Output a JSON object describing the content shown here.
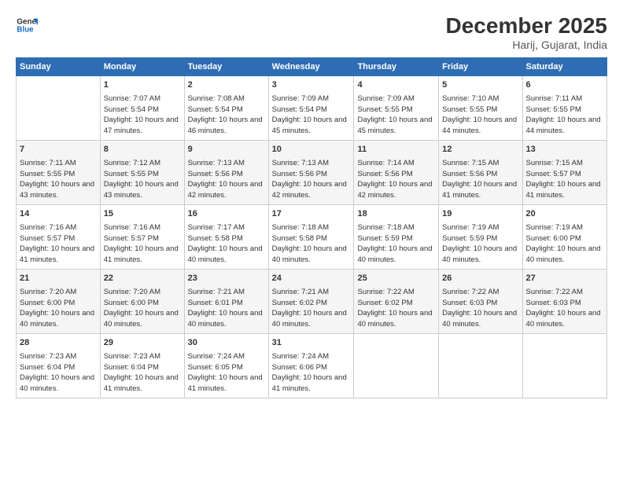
{
  "logo": {
    "line1": "General",
    "line2": "Blue"
  },
  "title": "December 2025",
  "location": "Harij, Gujarat, India",
  "weekdays": [
    "Sunday",
    "Monday",
    "Tuesday",
    "Wednesday",
    "Thursday",
    "Friday",
    "Saturday"
  ],
  "weeks": [
    [
      {
        "day": "",
        "sunrise": "",
        "sunset": "",
        "daylight": ""
      },
      {
        "day": "1",
        "sunrise": "Sunrise: 7:07 AM",
        "sunset": "Sunset: 5:54 PM",
        "daylight": "Daylight: 10 hours and 47 minutes."
      },
      {
        "day": "2",
        "sunrise": "Sunrise: 7:08 AM",
        "sunset": "Sunset: 5:54 PM",
        "daylight": "Daylight: 10 hours and 46 minutes."
      },
      {
        "day": "3",
        "sunrise": "Sunrise: 7:09 AM",
        "sunset": "Sunset: 5:54 PM",
        "daylight": "Daylight: 10 hours and 45 minutes."
      },
      {
        "day": "4",
        "sunrise": "Sunrise: 7:09 AM",
        "sunset": "Sunset: 5:55 PM",
        "daylight": "Daylight: 10 hours and 45 minutes."
      },
      {
        "day": "5",
        "sunrise": "Sunrise: 7:10 AM",
        "sunset": "Sunset: 5:55 PM",
        "daylight": "Daylight: 10 hours and 44 minutes."
      },
      {
        "day": "6",
        "sunrise": "Sunrise: 7:11 AM",
        "sunset": "Sunset: 5:55 PM",
        "daylight": "Daylight: 10 hours and 44 minutes."
      }
    ],
    [
      {
        "day": "7",
        "sunrise": "Sunrise: 7:11 AM",
        "sunset": "Sunset: 5:55 PM",
        "daylight": "Daylight: 10 hours and 43 minutes."
      },
      {
        "day": "8",
        "sunrise": "Sunrise: 7:12 AM",
        "sunset": "Sunset: 5:55 PM",
        "daylight": "Daylight: 10 hours and 43 minutes."
      },
      {
        "day": "9",
        "sunrise": "Sunrise: 7:13 AM",
        "sunset": "Sunset: 5:56 PM",
        "daylight": "Daylight: 10 hours and 42 minutes."
      },
      {
        "day": "10",
        "sunrise": "Sunrise: 7:13 AM",
        "sunset": "Sunset: 5:56 PM",
        "daylight": "Daylight: 10 hours and 42 minutes."
      },
      {
        "day": "11",
        "sunrise": "Sunrise: 7:14 AM",
        "sunset": "Sunset: 5:56 PM",
        "daylight": "Daylight: 10 hours and 42 minutes."
      },
      {
        "day": "12",
        "sunrise": "Sunrise: 7:15 AM",
        "sunset": "Sunset: 5:56 PM",
        "daylight": "Daylight: 10 hours and 41 minutes."
      },
      {
        "day": "13",
        "sunrise": "Sunrise: 7:15 AM",
        "sunset": "Sunset: 5:57 PM",
        "daylight": "Daylight: 10 hours and 41 minutes."
      }
    ],
    [
      {
        "day": "14",
        "sunrise": "Sunrise: 7:16 AM",
        "sunset": "Sunset: 5:57 PM",
        "daylight": "Daylight: 10 hours and 41 minutes."
      },
      {
        "day": "15",
        "sunrise": "Sunrise: 7:16 AM",
        "sunset": "Sunset: 5:57 PM",
        "daylight": "Daylight: 10 hours and 41 minutes."
      },
      {
        "day": "16",
        "sunrise": "Sunrise: 7:17 AM",
        "sunset": "Sunset: 5:58 PM",
        "daylight": "Daylight: 10 hours and 40 minutes."
      },
      {
        "day": "17",
        "sunrise": "Sunrise: 7:18 AM",
        "sunset": "Sunset: 5:58 PM",
        "daylight": "Daylight: 10 hours and 40 minutes."
      },
      {
        "day": "18",
        "sunrise": "Sunrise: 7:18 AM",
        "sunset": "Sunset: 5:59 PM",
        "daylight": "Daylight: 10 hours and 40 minutes."
      },
      {
        "day": "19",
        "sunrise": "Sunrise: 7:19 AM",
        "sunset": "Sunset: 5:59 PM",
        "daylight": "Daylight: 10 hours and 40 minutes."
      },
      {
        "day": "20",
        "sunrise": "Sunrise: 7:19 AM",
        "sunset": "Sunset: 6:00 PM",
        "daylight": "Daylight: 10 hours and 40 minutes."
      }
    ],
    [
      {
        "day": "21",
        "sunrise": "Sunrise: 7:20 AM",
        "sunset": "Sunset: 6:00 PM",
        "daylight": "Daylight: 10 hours and 40 minutes."
      },
      {
        "day": "22",
        "sunrise": "Sunrise: 7:20 AM",
        "sunset": "Sunset: 6:00 PM",
        "daylight": "Daylight: 10 hours and 40 minutes."
      },
      {
        "day": "23",
        "sunrise": "Sunrise: 7:21 AM",
        "sunset": "Sunset: 6:01 PM",
        "daylight": "Daylight: 10 hours and 40 minutes."
      },
      {
        "day": "24",
        "sunrise": "Sunrise: 7:21 AM",
        "sunset": "Sunset: 6:02 PM",
        "daylight": "Daylight: 10 hours and 40 minutes."
      },
      {
        "day": "25",
        "sunrise": "Sunrise: 7:22 AM",
        "sunset": "Sunset: 6:02 PM",
        "daylight": "Daylight: 10 hours and 40 minutes."
      },
      {
        "day": "26",
        "sunrise": "Sunrise: 7:22 AM",
        "sunset": "Sunset: 6:03 PM",
        "daylight": "Daylight: 10 hours and 40 minutes."
      },
      {
        "day": "27",
        "sunrise": "Sunrise: 7:22 AM",
        "sunset": "Sunset: 6:03 PM",
        "daylight": "Daylight: 10 hours and 40 minutes."
      }
    ],
    [
      {
        "day": "28",
        "sunrise": "Sunrise: 7:23 AM",
        "sunset": "Sunset: 6:04 PM",
        "daylight": "Daylight: 10 hours and 40 minutes."
      },
      {
        "day": "29",
        "sunrise": "Sunrise: 7:23 AM",
        "sunset": "Sunset: 6:04 PM",
        "daylight": "Daylight: 10 hours and 41 minutes."
      },
      {
        "day": "30",
        "sunrise": "Sunrise: 7:24 AM",
        "sunset": "Sunset: 6:05 PM",
        "daylight": "Daylight: 10 hours and 41 minutes."
      },
      {
        "day": "31",
        "sunrise": "Sunrise: 7:24 AM",
        "sunset": "Sunset: 6:06 PM",
        "daylight": "Daylight: 10 hours and 41 minutes."
      },
      {
        "day": "",
        "sunrise": "",
        "sunset": "",
        "daylight": ""
      },
      {
        "day": "",
        "sunrise": "",
        "sunset": "",
        "daylight": ""
      },
      {
        "day": "",
        "sunrise": "",
        "sunset": "",
        "daylight": ""
      }
    ]
  ]
}
